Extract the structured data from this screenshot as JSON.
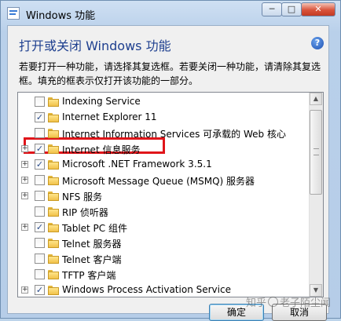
{
  "window": {
    "title": "Windows 功能",
    "controls": {
      "minimize": "─",
      "maximize": "□",
      "close": "✕"
    }
  },
  "dialog": {
    "heading": "打开或关闭 Windows 功能",
    "help": "?",
    "description": "若要打开一种功能，请选择其复选框。若要关闭一种功能，请清除其复选框。填充的框表示仅打开该功能的一部分。"
  },
  "features": [
    {
      "label": "Indexing Service",
      "checked": false,
      "expandable": false
    },
    {
      "label": "Internet Explorer 11",
      "checked": true,
      "expandable": false
    },
    {
      "label": "Internet Information Services 可承载的 Web 核心",
      "checked": false,
      "expandable": false
    },
    {
      "label": "Internet 信息服务",
      "checked": true,
      "expandable": true
    },
    {
      "label": "Microsoft .NET Framework 3.5.1",
      "checked": true,
      "expandable": true
    },
    {
      "label": "Microsoft Message Queue (MSMQ) 服务器",
      "checked": false,
      "expandable": true
    },
    {
      "label": "NFS 服务",
      "checked": false,
      "expandable": true
    },
    {
      "label": "RIP 侦听器",
      "checked": false,
      "expandable": false
    },
    {
      "label": "Tablet PC 组件",
      "checked": true,
      "expandable": true
    },
    {
      "label": "Telnet 服务器",
      "checked": false,
      "expandable": false
    },
    {
      "label": "Telnet 客户端",
      "checked": false,
      "expandable": false
    },
    {
      "label": "TFTP 客户端",
      "checked": false,
      "expandable": false
    },
    {
      "label": "Windows Process Activation Service",
      "checked": true,
      "expandable": true
    }
  ],
  "buttons": {
    "ok": "确定",
    "cancel": "取消"
  },
  "watermark": {
    "text_a": "知乎",
    "text_b": "老子陌尘闻"
  },
  "colors": {
    "highlight_box": "#e0151a",
    "heading": "#1e3f8f"
  }
}
